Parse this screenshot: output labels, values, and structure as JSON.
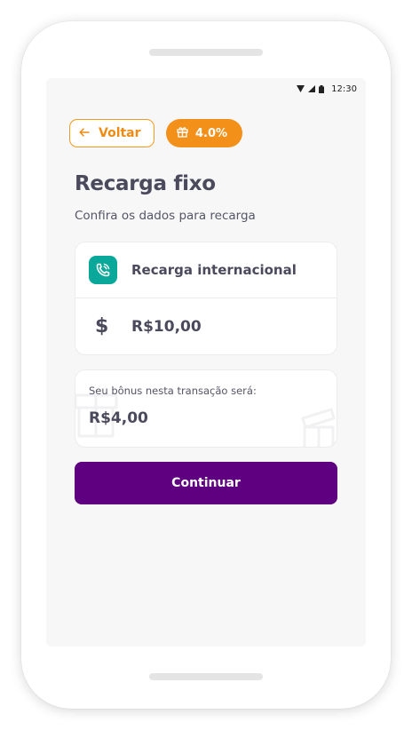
{
  "statusbar": {
    "time": "12:30"
  },
  "header": {
    "back_label": "Voltar",
    "bonus_percent": "4.0%"
  },
  "page": {
    "title": "Recarga fixo",
    "subtitle": "Confira os dados para recarga"
  },
  "details": {
    "type_label": "Recarga internacional",
    "amount": "R$10,00"
  },
  "bonus": {
    "label": "Seu bônus nesta transação será:",
    "value": "R$4,00"
  },
  "actions": {
    "continue_label": "Continuar"
  },
  "colors": {
    "accent_orange": "#f39019",
    "brand_purple": "#5e0080",
    "teal": "#0aa89a"
  }
}
